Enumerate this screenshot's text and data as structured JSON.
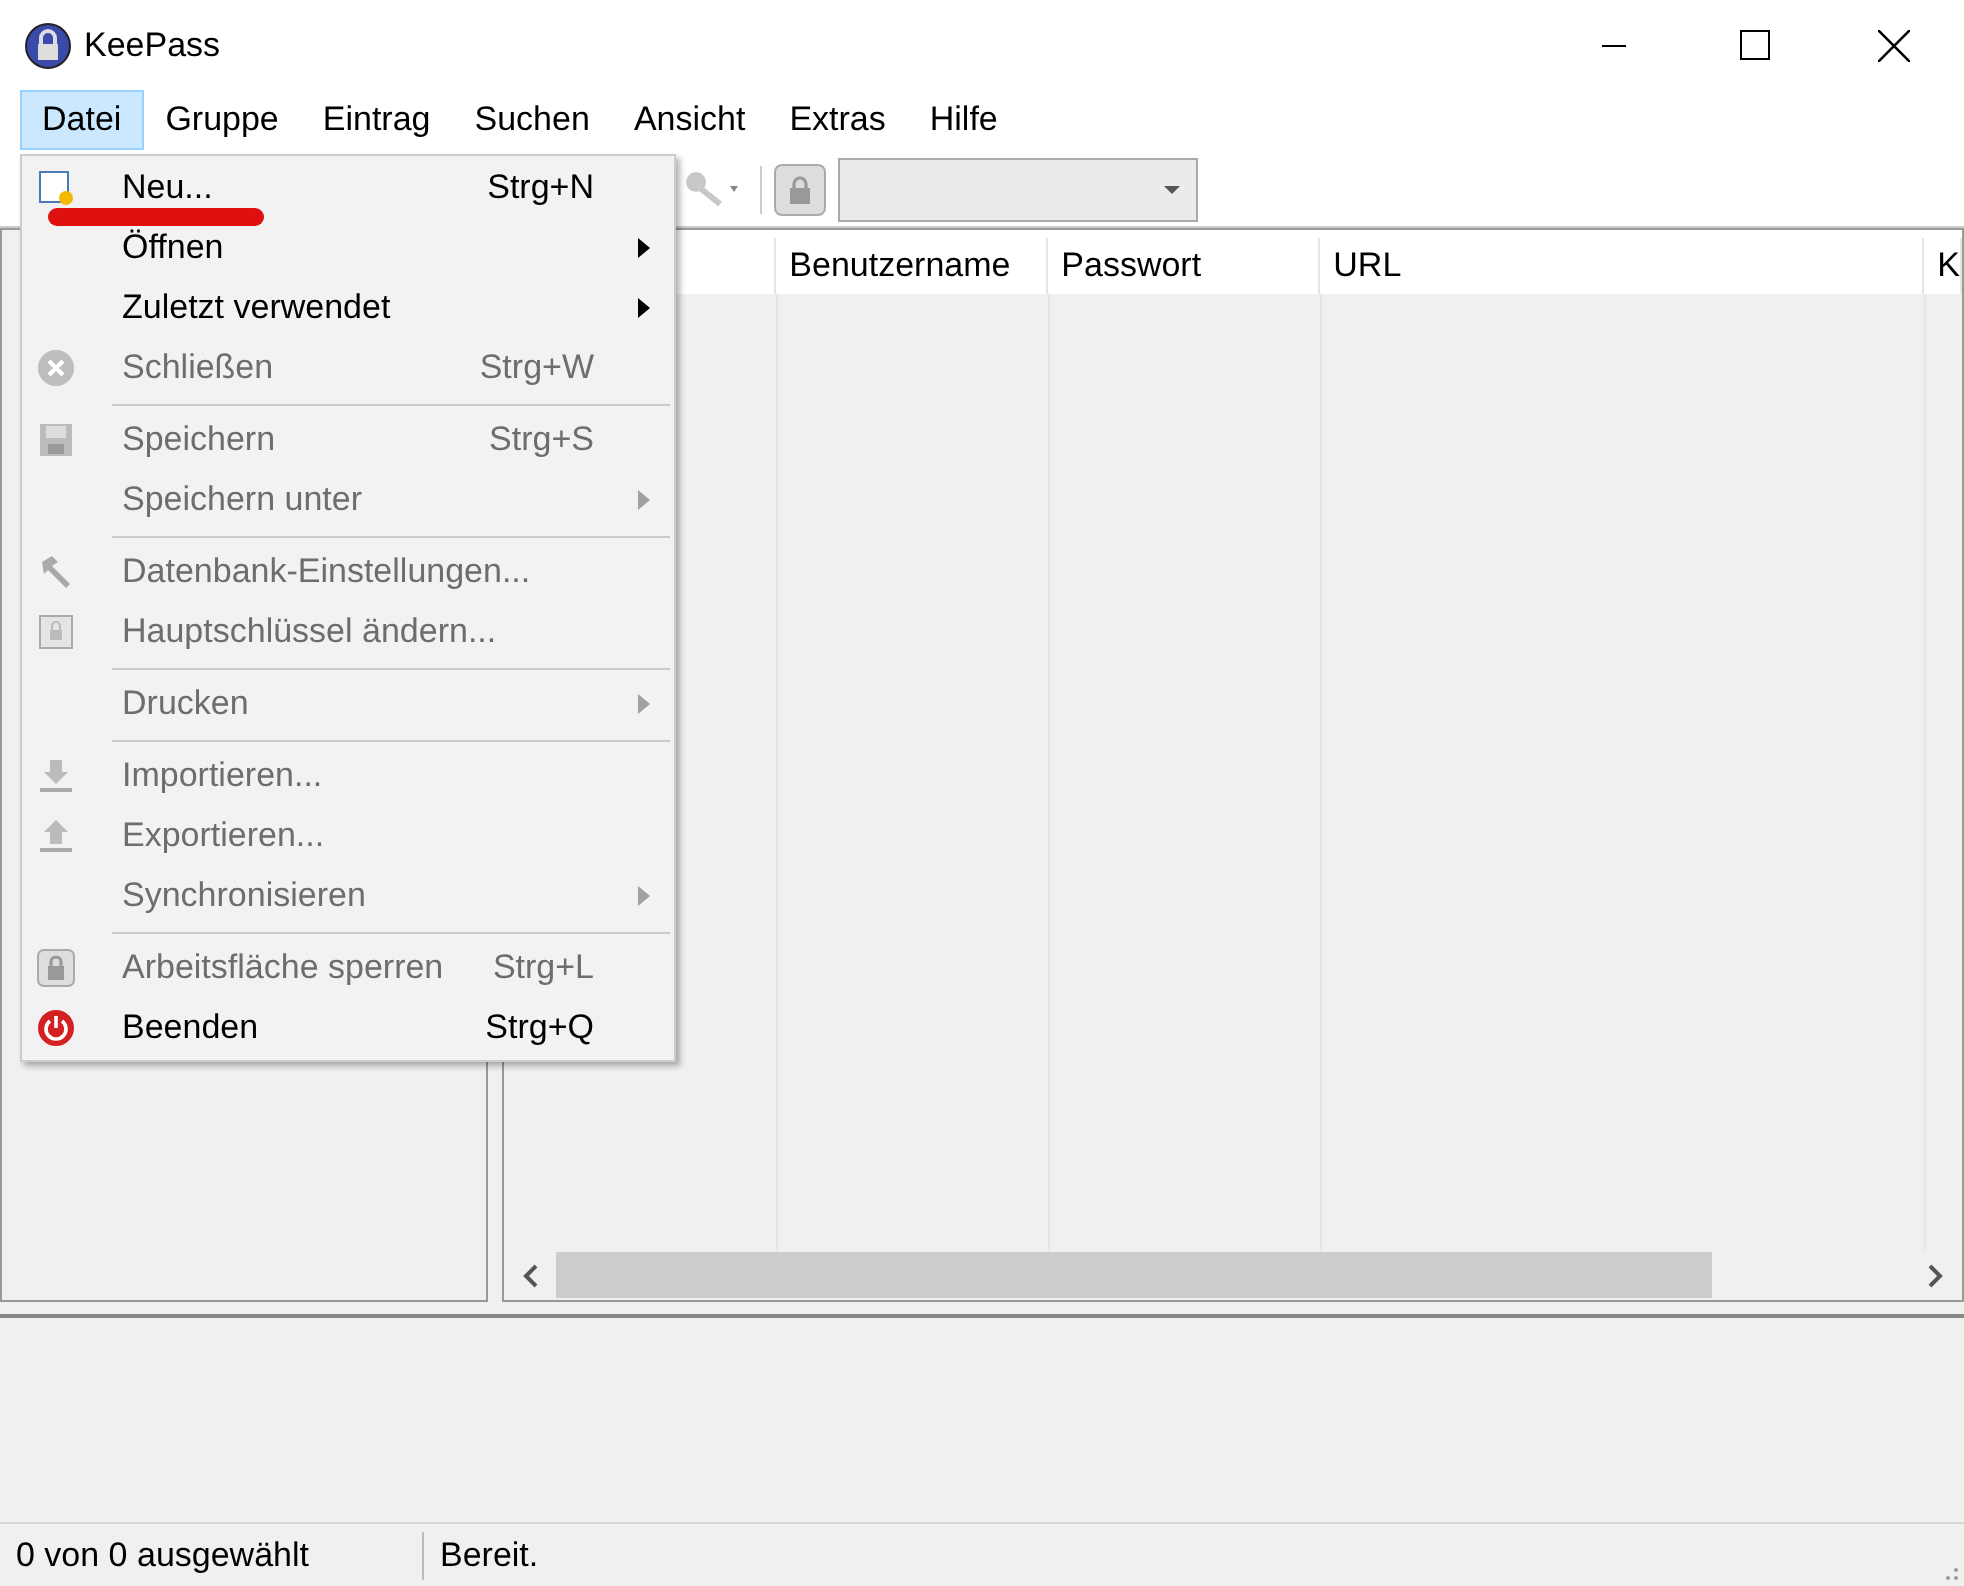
{
  "window": {
    "title": "KeePass"
  },
  "menu_bar": [
    {
      "label": "Datei",
      "selected": true
    },
    {
      "label": "Gruppe",
      "selected": false
    },
    {
      "label": "Eintrag",
      "selected": false
    },
    {
      "label": "Suchen",
      "selected": false
    },
    {
      "label": "Ansicht",
      "selected": false
    },
    {
      "label": "Extras",
      "selected": false
    },
    {
      "label": "Hilfe",
      "selected": false
    }
  ],
  "file_menu": [
    {
      "kind": "item",
      "label": "Neu...",
      "shortcut": "Strg+N",
      "disabled": false,
      "submenu": false
    },
    {
      "kind": "item",
      "label": "Öffnen",
      "disabled": false,
      "submenu": true
    },
    {
      "kind": "item",
      "label": "Zuletzt verwendet",
      "disabled": false,
      "submenu": true
    },
    {
      "kind": "item",
      "label": "Schließen",
      "shortcut": "Strg+W",
      "disabled": true,
      "submenu": false
    },
    {
      "kind": "separator"
    },
    {
      "kind": "item",
      "label": "Speichern",
      "shortcut": "Strg+S",
      "disabled": true,
      "submenu": false
    },
    {
      "kind": "item",
      "label": "Speichern unter",
      "disabled": true,
      "submenu": true
    },
    {
      "kind": "separator"
    },
    {
      "kind": "item",
      "label": "Datenbank-Einstellungen...",
      "disabled": true,
      "submenu": false
    },
    {
      "kind": "item",
      "label": "Hauptschlüssel ändern...",
      "disabled": true,
      "submenu": false
    },
    {
      "kind": "separator"
    },
    {
      "kind": "item",
      "label": "Drucken",
      "disabled": true,
      "submenu": true
    },
    {
      "kind": "separator"
    },
    {
      "kind": "item",
      "label": "Importieren...",
      "disabled": true,
      "submenu": false
    },
    {
      "kind": "item",
      "label": "Exportieren...",
      "disabled": true,
      "submenu": false
    },
    {
      "kind": "item",
      "label": "Synchronisieren",
      "disabled": true,
      "submenu": true
    },
    {
      "kind": "separator"
    },
    {
      "kind": "item",
      "label": "Arbeitsfläche sperren",
      "shortcut": "Strg+L",
      "disabled": true,
      "submenu": false
    },
    {
      "kind": "item",
      "label": "Beenden",
      "shortcut": "Strg+Q",
      "disabled": false,
      "submenu": false
    }
  ],
  "table": {
    "columns": [
      "Benutzername",
      "Passwort",
      "URL",
      "K"
    ]
  },
  "status_bar": [
    "0 von 0 ausgewählt",
    "Bereit."
  ]
}
